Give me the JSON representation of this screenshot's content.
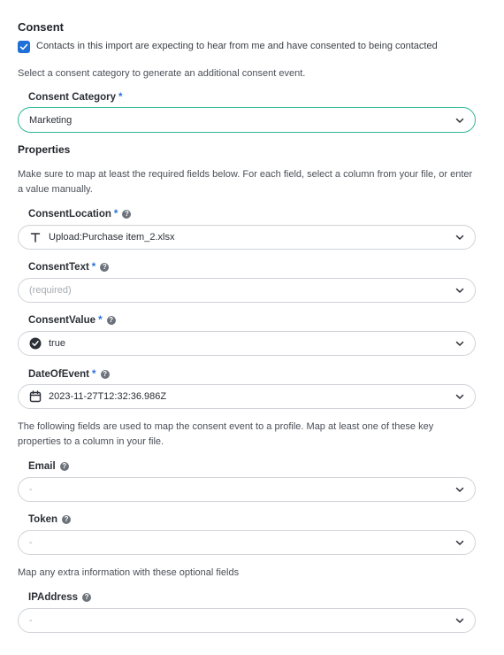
{
  "consent": {
    "title": "Consent",
    "checkbox_label": "Contacts in this import are expecting to hear from me and have consented to being contacted",
    "checked": true,
    "category_hint": "Select a consent category to generate an additional consent event.",
    "category_label": "Consent Category",
    "category_value": "Marketing"
  },
  "properties": {
    "title": "Properties",
    "hint": "Make sure to map at least the required fields below. For each field, select a column from your file, or enter a value manually.",
    "fields": [
      {
        "label": "ConsentLocation",
        "value": "Upload:Purchase item_2.xlsx",
        "icon": "text-type-icon"
      },
      {
        "label": "ConsentText",
        "value": "(required)",
        "icon": ""
      },
      {
        "label": "ConsentValue",
        "value": "true",
        "icon": "check-circle-icon"
      },
      {
        "label": "DateOfEvent",
        "value": "2023-11-27T12:32:36.986Z",
        "icon": "calendar-icon"
      }
    ]
  },
  "profile": {
    "hint": "The following fields are used to map the consent event to a profile. Map at least one of these key properties to a column in your file.",
    "fields": [
      {
        "label": "Email",
        "value": "-"
      },
      {
        "label": "Token",
        "value": "-"
      }
    ]
  },
  "optional": {
    "hint": "Map any extra information with these optional fields",
    "fields": [
      {
        "label": "IPAddress",
        "value": "-"
      }
    ]
  },
  "required_marker": "*",
  "help_glyph": "?",
  "colors": {
    "accent": "#1f6fd8",
    "active_border": "#35b79a",
    "required": "#2a6fdb"
  }
}
